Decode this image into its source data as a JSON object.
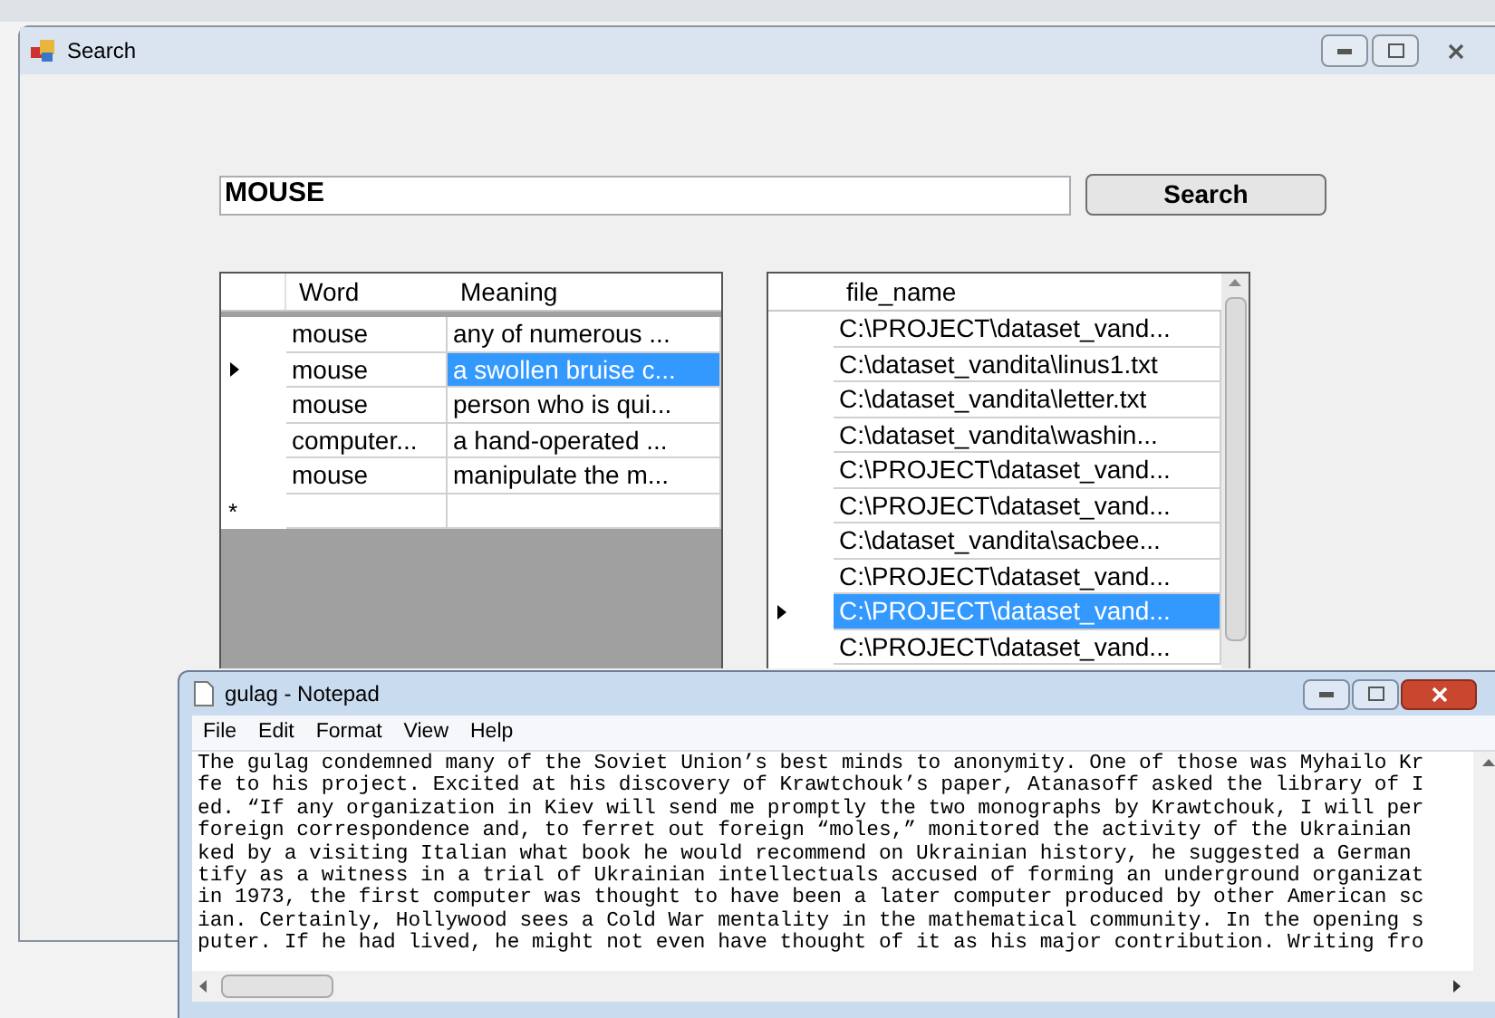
{
  "search_window": {
    "title": "Search",
    "query": "MOUSE",
    "search_button": "Search",
    "words_grid": {
      "columns": [
        "Word",
        "Meaning"
      ],
      "new_row_marker": "*",
      "rows": [
        {
          "word": "mouse",
          "meaning": "any of numerous ...",
          "selected": false
        },
        {
          "word": "mouse",
          "meaning": "a swollen bruise c...",
          "selected": true
        },
        {
          "word": "mouse",
          "meaning": "person who is qui...",
          "selected": false
        },
        {
          "word": "computer...",
          "meaning": "a hand-operated ...",
          "selected": false
        },
        {
          "word": "mouse",
          "meaning": "manipulate the m...",
          "selected": false
        }
      ]
    },
    "files_grid": {
      "columns": [
        "file_name"
      ],
      "rows": [
        {
          "file_name": "C:\\PROJECT\\dataset_vand...",
          "selected": false
        },
        {
          "file_name": "C:\\dataset_vandita\\linus1.txt",
          "selected": false
        },
        {
          "file_name": "C:\\dataset_vandita\\letter.txt",
          "selected": false
        },
        {
          "file_name": "C:\\dataset_vandita\\washin...",
          "selected": false
        },
        {
          "file_name": "C:\\PROJECT\\dataset_vand...",
          "selected": false
        },
        {
          "file_name": "C:\\PROJECT\\dataset_vand...",
          "selected": false
        },
        {
          "file_name": "C:\\dataset_vandita\\sacbee...",
          "selected": false
        },
        {
          "file_name": "C:\\PROJECT\\dataset_vand...",
          "selected": false
        },
        {
          "file_name": "C:\\PROJECT\\dataset_vand...",
          "selected": true
        },
        {
          "file_name": "C:\\PROJECT\\dataset_vand...",
          "selected": false
        }
      ]
    }
  },
  "notepad": {
    "title": "gulag - Notepad",
    "menu": [
      "File",
      "Edit",
      "Format",
      "View",
      "Help"
    ],
    "lines": [
      "The gulag condemned many of the Soviet Union’s best minds to anonymity. One of those was Myhailo Kr",
      "fe to his project. Excited at his discovery of Krawtchouk’s paper, Atanasoff asked the library of I",
      "ed. “If any organization in Kiev will send me promptly the two monographs by Krawtchouk, I will per",
      "foreign correspondence and, to ferret out foreign “moles,” monitored the activity of the Ukrainian",
      "ked by a visiting Italian what book he would recommend on Ukrainian history, he suggested a German",
      "tify as a witness in a trial of Ukrainian intellectuals accused of forming an underground organizat",
      "in 1973, the first computer was thought to have been a later computer produced by other American sc",
      "ian. Certainly, Hollywood sees a Cold War mentality in the mathematical community. In the opening s",
      "puter. If he had lived, he might not even have thought of it as his major contribution. Writing fro"
    ]
  }
}
